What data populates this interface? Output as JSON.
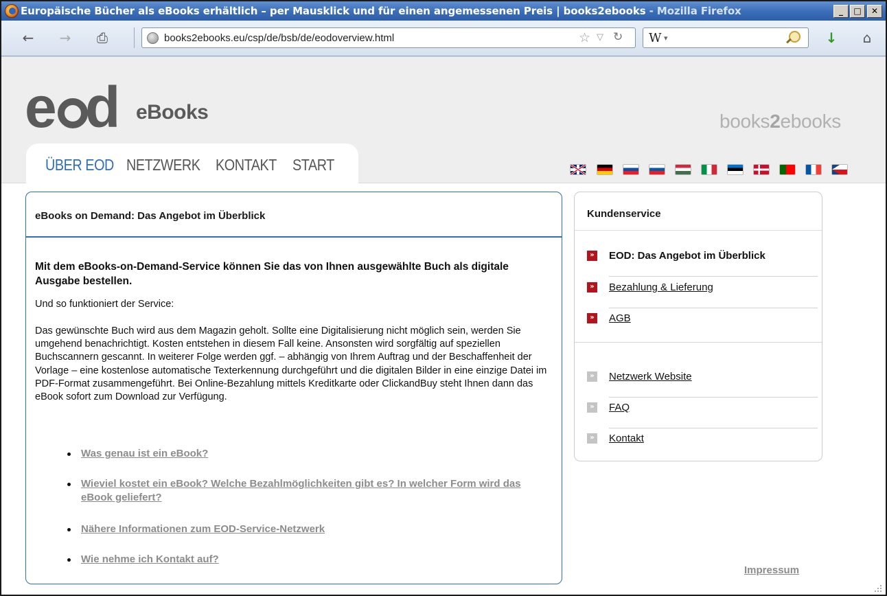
{
  "window": {
    "title_main": "Europäische Bücher als eBooks erhältlich – per Mausklick und für einen angemessenen Preis | books2ebooks",
    "title_app": " - Mozilla Firefox",
    "btn_min": "_",
    "btn_max": "□",
    "btn_close": "✕"
  },
  "toolbar": {
    "url": "books2ebooks.eu/csp/de/bsb/de/eodoverview.html",
    "search_engine": "W",
    "search_engine_dd": "▾",
    "icons": [
      "back-icon",
      "forward-icon",
      "print-icon",
      "site-globe-icon",
      "bookmark-star-icon",
      "url-dropdown-icon",
      "reload-icon",
      "search-magnifier-icon",
      "download-icon",
      "home-icon"
    ]
  },
  "header": {
    "logo_e": "e",
    "logo_d": "d",
    "brand": "eBooks",
    "brand_right_a": "books",
    "brand_right_b": "2",
    "brand_right_c": "ebooks",
    "nav": [
      "ÜBER EOD",
      "NETZWERK",
      "KONTAKT",
      "START"
    ],
    "flags": [
      "uk-flag",
      "german-flag",
      "slovak-flag",
      "slovenian-flag",
      "hungarian-flag",
      "italian-flag",
      "estonian-flag",
      "danish-flag",
      "portuguese-flag",
      "french-flag",
      "czech-flag"
    ]
  },
  "main": {
    "title": "eBooks on Demand: Das Angebot im Überblick",
    "lead": "Mit dem eBooks-on-Demand-Service können Sie das von Ihnen ausgewählte Buch als digitale Ausgabe bestellen.",
    "intro": "Und so funktioniert der Service:",
    "body": "Das gewünschte Buch wird aus dem Magazin geholt. Sollte eine Digitalisierung nicht möglich sein, werden Sie umgehend benachrichtigt. Kosten entstehen in diesem Fall keine. Ansonsten wird sorgfältig auf speziellen Buchscannern gescannt. In weiterer Folge werden ggf. – abhängig von Ihrem Auftrag und der Beschaffenheit der Vorlage – eine kostenlose automatische Texterkennung durchgeführt und die digitalen Bilder in eine einzige Datei im PDF-Format zusammengeführt. Bei Online-Bezahlung mittels Kreditkarte oder ClickandBuy steht Ihnen dann das eBook sofort zum Download zur Verfügung.",
    "links": [
      "Was genau ist ein eBook?",
      "Wieviel kostet ein eBook? Welche Bezahlmöglichkeiten gibt es? In welcher Form wird das eBook geliefert?",
      "Nähere Informationen zum EOD-Service-Netzwerk",
      "Wie nehme ich Kontakt auf?"
    ]
  },
  "sidebar": {
    "title": "Kundenservice",
    "marker": "»",
    "items": [
      {
        "label": "EOD: Das Angebot im Überblick"
      },
      {
        "label": "Bezahlung & Lieferung"
      },
      {
        "label": "AGB"
      },
      {
        "label": "Netzwerk Website"
      },
      {
        "label": "FAQ"
      },
      {
        "label": "Kontakt"
      }
    ]
  },
  "footer": {
    "impressum": "Impressum"
  }
}
